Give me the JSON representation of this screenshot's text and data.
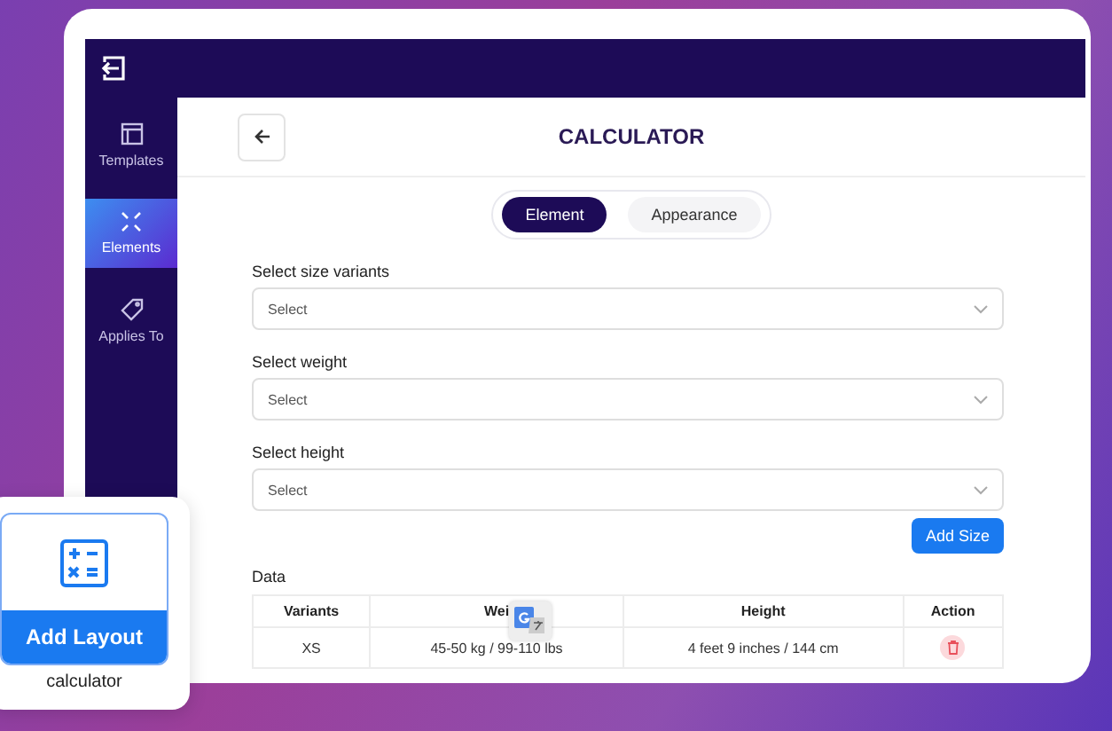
{
  "sidebar": {
    "items": [
      {
        "label": "Templates",
        "selected": false
      },
      {
        "label": "Elements",
        "selected": true
      },
      {
        "label": "Applies To",
        "selected": false
      }
    ]
  },
  "header": {
    "title": "CALCULATOR"
  },
  "tabs": [
    {
      "label": "Element",
      "selected": true
    },
    {
      "label": "Appearance",
      "selected": false
    }
  ],
  "fields": [
    {
      "label": "Select size variants",
      "placeholder": "Select"
    },
    {
      "label": "Select weight",
      "placeholder": "Select"
    },
    {
      "label": "Select height",
      "placeholder": "Select"
    }
  ],
  "add_button": "Add Size",
  "table": {
    "title": "Data",
    "columns": [
      "Variants",
      "Wei",
      "Height",
      "Action"
    ],
    "rows": [
      {
        "cells": [
          "XS",
          "45-50 kg / 99-110 lbs",
          "4 feet 9 inches / 144 cm"
        ]
      }
    ]
  },
  "layout_card": {
    "button": "Add Layout",
    "caption": "calculator"
  }
}
